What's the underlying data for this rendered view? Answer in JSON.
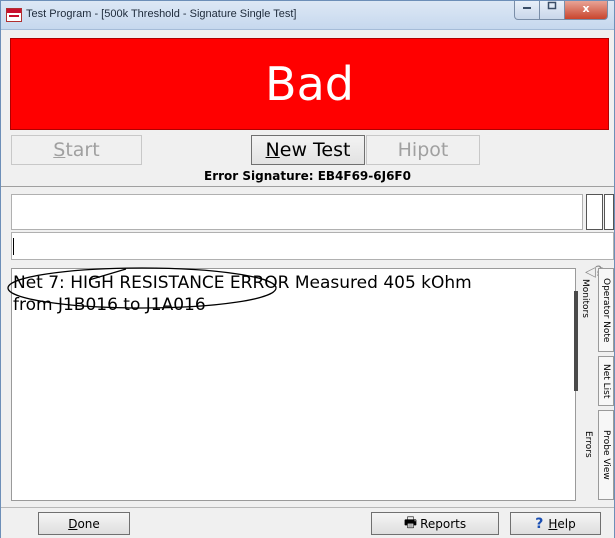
{
  "window": {
    "title": "Test Program - [500k Threshold - Signature Single Test]",
    "close_glyph": "x"
  },
  "status": {
    "text": "Bad",
    "color": "#ff0000"
  },
  "buttons": {
    "start": "Start",
    "new_test": "New Test",
    "hipot": "Hipot"
  },
  "signature": {
    "text": "Error Signature: EB4F69-6J6F0"
  },
  "nav": {
    "arrows": "◁?▷"
  },
  "messages": {
    "line1": "Net 7:  HIGH RESISTANCE ERROR Measured 405 kOhm",
    "line2": "from J1B016 to J1A016"
  },
  "side_tabs": {
    "operator_note": "Operator Note",
    "net_list": "Net List",
    "probe_view": "Probe View",
    "monitors": "Monitors",
    "errors": "Errors"
  },
  "bottom": {
    "done": "Done",
    "reports": "Reports",
    "help": "Help",
    "help_glyph": "?",
    "printer_glyph": "🖶"
  },
  "icons": {
    "app": "app-icon",
    "printer": "printer-icon",
    "help": "help-icon"
  }
}
